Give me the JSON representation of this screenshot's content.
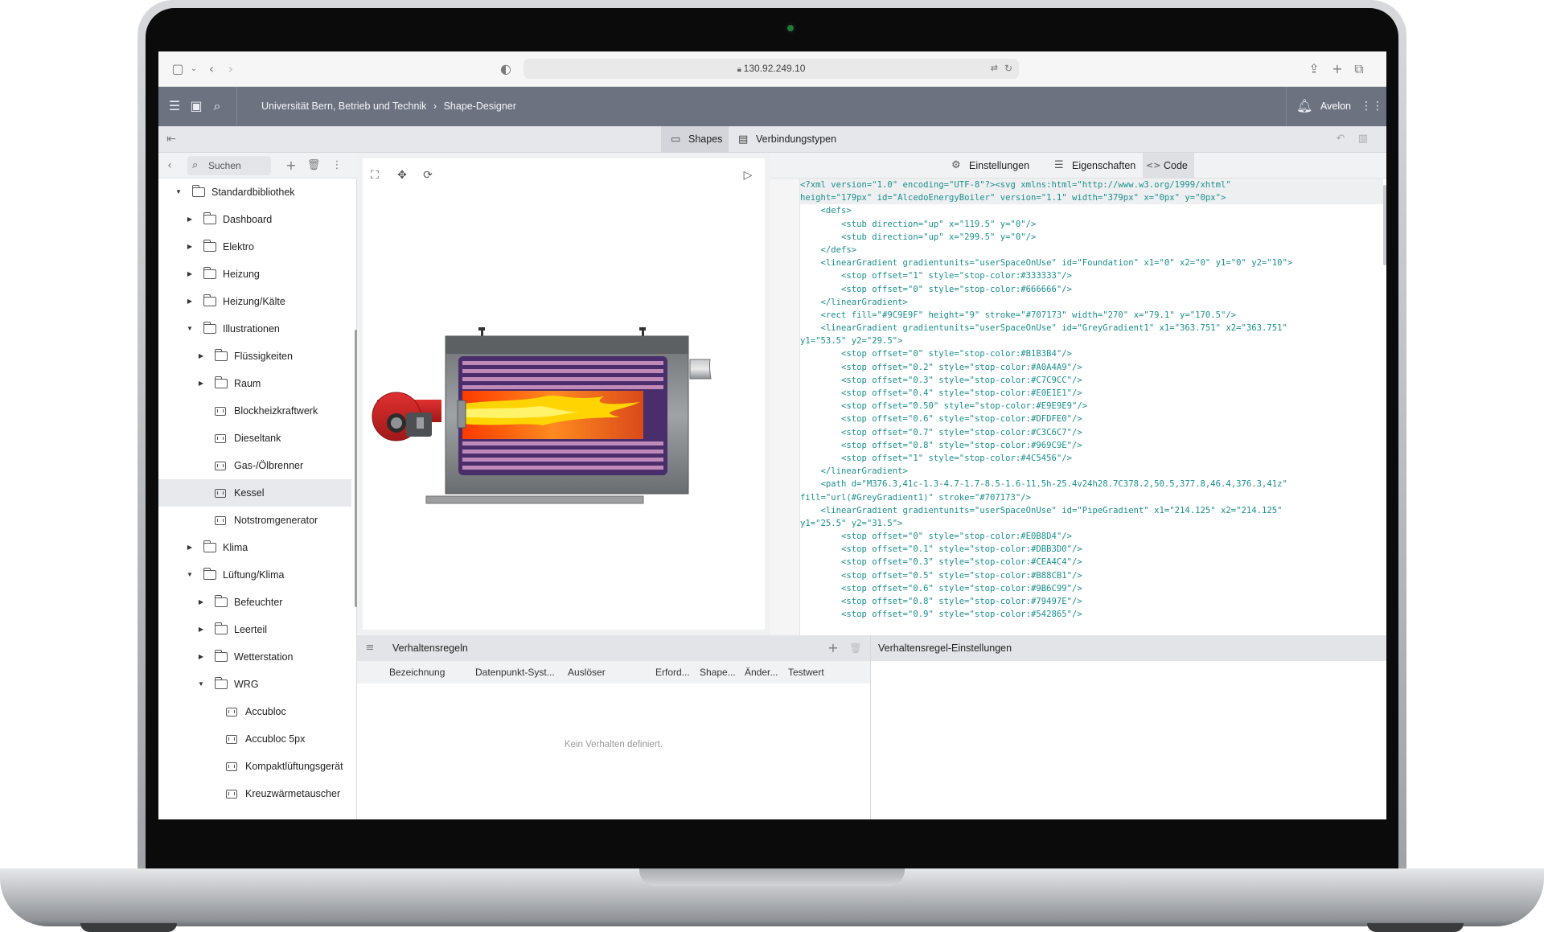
{
  "browser": {
    "url": "130.92.249.10"
  },
  "app": {
    "breadcrumb": "Universität Bern, Betrieb und Technik",
    "breadcrumb_sep": "›",
    "page": "Shape-Designer",
    "user": "Avelon"
  },
  "tabs": [
    {
      "label": "Shapes"
    },
    {
      "label": "Verbindungstypen"
    }
  ],
  "sidebar": {
    "search_placeholder": "Suchen",
    "tree": [
      {
        "label": "Standardbibliothek",
        "type": "folder",
        "expanded": true
      },
      {
        "label": "Dashboard",
        "type": "folder",
        "expanded": false
      },
      {
        "label": "Elektro",
        "type": "folder",
        "expanded": false
      },
      {
        "label": "Heizung",
        "type": "folder",
        "expanded": false
      },
      {
        "label": "Heizung/Kälte",
        "type": "folder",
        "expanded": false
      },
      {
        "label": "Illustrationen",
        "type": "folder",
        "expanded": true
      },
      {
        "label": "Flüssigkeiten",
        "type": "folder",
        "expanded": false
      },
      {
        "label": "Raum",
        "type": "folder",
        "expanded": false
      },
      {
        "label": "Blockheizkraftwerk",
        "type": "shape"
      },
      {
        "label": "Dieseltank",
        "type": "shape"
      },
      {
        "label": "Gas-/Ölbrenner",
        "type": "shape"
      },
      {
        "label": "Kessel",
        "type": "shape",
        "selected": true
      },
      {
        "label": "Notstromgenerator",
        "type": "shape"
      },
      {
        "label": "Klima",
        "type": "folder",
        "expanded": false
      },
      {
        "label": "Lüftung/Klima",
        "type": "folder",
        "expanded": true
      },
      {
        "label": "Befeuchter",
        "type": "folder",
        "expanded": false
      },
      {
        "label": "Leerteil",
        "type": "folder",
        "expanded": false
      },
      {
        "label": "Wetterstation",
        "type": "folder",
        "expanded": false
      },
      {
        "label": "WRG",
        "type": "folder",
        "expanded": true
      },
      {
        "label": "Accubloc",
        "type": "shape"
      },
      {
        "label": "Accubloc 5px",
        "type": "shape"
      },
      {
        "label": "Kompaktlüftungsgerät",
        "type": "shape"
      },
      {
        "label": "Kreuzwärmetauscher",
        "type": "shape"
      }
    ]
  },
  "editor_tabs": [
    {
      "label": "Einstellungen",
      "icon": "gear-icon"
    },
    {
      "label": "Eigenschaften",
      "icon": "list-icon"
    },
    {
      "label": "Code",
      "icon": "code-icon"
    }
  ],
  "code_lines": [
    {
      "n": "1",
      "text": "<?xml version=\"1.0\" encoding=\"UTF-8\"?><svg xmlns:html=\"http://www.w3.org/1999/xhtml\""
    },
    {
      "n": "",
      "text": "height=\"179px\" id=\"AlcedoEnergyBoiler\" version=\"1.1\" width=\"379px\" x=\"0px\" y=\"0px\">"
    },
    {
      "n": "2",
      "text": "    <defs>"
    },
    {
      "n": "3",
      "text": "        <stub direction=\"up\" x=\"119.5\" y=\"0\"/>"
    },
    {
      "n": "4",
      "text": "        <stub direction=\"up\" x=\"299.5\" y=\"0\"/>"
    },
    {
      "n": "5",
      "text": "    </defs>"
    },
    {
      "n": "6",
      "text": "    <linearGradient gradientunits=\"userSpaceOnUse\" id=\"Foundation\" x1=\"0\" x2=\"0\" y1=\"0\" y2=\"10\">"
    },
    {
      "n": "7",
      "text": "        <stop offset=\"1\" style=\"stop-color:#333333\"/>"
    },
    {
      "n": "8",
      "text": "        <stop offset=\"0\" style=\"stop-color:#666666\"/>"
    },
    {
      "n": "9",
      "text": "    </linearGradient>"
    },
    {
      "n": "10",
      "text": "    <rect fill=\"#9C9E9F\" height=\"9\" stroke=\"#707173\" width=\"270\" x=\"79.1\" y=\"170.5\"/>"
    },
    {
      "n": "11",
      "text": "    <linearGradient gradientunits=\"userSpaceOnUse\" id=\"GreyGradient1\" x1=\"363.751\" x2=\"363.751\""
    },
    {
      "n": "",
      "text": "y1=\"53.5\" y2=\"29.5\">"
    },
    {
      "n": "12",
      "text": "        <stop offset=\"0\" style=\"stop-color:#B1B3B4\"/>"
    },
    {
      "n": "13",
      "text": "        <stop offset=\"0.2\" style=\"stop-color:#A0A4A9\"/>"
    },
    {
      "n": "14",
      "text": "        <stop offset=\"0.3\" style=\"stop-color:#C7C9CC\"/>"
    },
    {
      "n": "15",
      "text": "        <stop offset=\"0.4\" style=\"stop-color:#E0E1E1\"/>"
    },
    {
      "n": "16",
      "text": "        <stop offset=\"0.50\" style=\"stop-color:#E9E9E9\"/>"
    },
    {
      "n": "17",
      "text": "        <stop offset=\"0.6\" style=\"stop-color:#DFDFE0\"/>"
    },
    {
      "n": "18",
      "text": "        <stop offset=\"0.7\" style=\"stop-color:#C3C6C7\"/>"
    },
    {
      "n": "19",
      "text": "        <stop offset=\"0.8\" style=\"stop-color:#969C9E\"/>"
    },
    {
      "n": "20",
      "text": "        <stop offset=\"1\" style=\"stop-color:#4C5456\"/>"
    },
    {
      "n": "21",
      "text": "    </linearGradient>"
    },
    {
      "n": "22",
      "text": "    <path d=\"M376.3,41c-1.3-4.7-1.7-8.5-1.6-11.5h-25.4v24h28.7C378.2,50.5,377.8,46.4,376.3,41z\""
    },
    {
      "n": "",
      "text": "fill=\"url(#GreyGradient1)\" stroke=\"#707173\"/>"
    },
    {
      "n": "23",
      "text": "    <linearGradient gradientunits=\"userSpaceOnUse\" id=\"PipeGradient\" x1=\"214.125\" x2=\"214.125\""
    },
    {
      "n": "",
      "text": "y1=\"25.5\" y2=\"31.5\">"
    },
    {
      "n": "24",
      "text": "        <stop offset=\"0\" style=\"stop-color:#E0B8D4\"/>"
    },
    {
      "n": "25",
      "text": "        <stop offset=\"0.1\" style=\"stop-color:#DBB3D0\"/>"
    },
    {
      "n": "26",
      "text": "        <stop offset=\"0.3\" style=\"stop-color:#CEA4C4\"/>"
    },
    {
      "n": "27",
      "text": "        <stop offset=\"0.5\" style=\"stop-color:#B88CB1\"/>"
    },
    {
      "n": "28",
      "text": "        <stop offset=\"0.6\" style=\"stop-color:#9B6C99\"/>"
    },
    {
      "n": "29",
      "text": "        <stop offset=\"0.8\" style=\"stop-color:#79497E\"/>"
    },
    {
      "n": "30",
      "text": "        <stop offset=\"0.9\" style=\"stop-color:#542865\"/>"
    }
  ],
  "behavior": {
    "title": "Verhaltensregeln",
    "settings_title": "Verhaltensregel-Einstellungen",
    "columns": [
      "Bezeichnung",
      "Datenpunkt-Syst...",
      "Auslöser",
      "Erford...",
      "Shape...",
      "Änder...",
      "Testwert"
    ],
    "empty": "Kein Verhalten definiert."
  },
  "colors": {
    "appbar": "#6c7280",
    "tag": "#1a8f8c",
    "string": "#1aa3c4"
  }
}
